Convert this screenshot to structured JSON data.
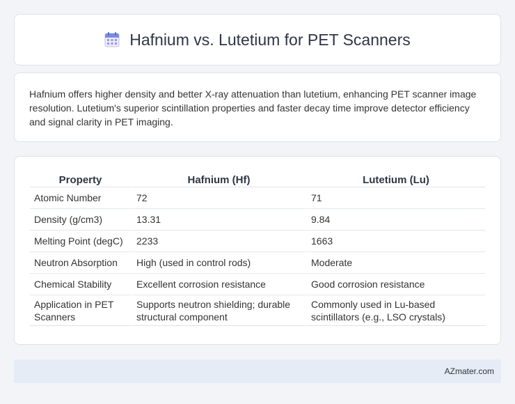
{
  "header": {
    "icon": "calendar-icon",
    "title": "Hafnium vs. Lutetium for PET Scanners"
  },
  "summary": {
    "text": "Hafnium offers higher density and better X-ray attenuation than lutetium, enhancing PET scanner image resolution. Lutetium's superior scintillation properties and faster decay time improve detector efficiency and signal clarity in PET imaging."
  },
  "table": {
    "headers": [
      "Property",
      "Hafnium (Hf)",
      "Lutetium (Lu)"
    ],
    "rows": [
      [
        "Atomic Number",
        "72",
        "71"
      ],
      [
        "Density (g/cm3)",
        "13.31",
        "9.84"
      ],
      [
        "Melting Point (degC)",
        "2233",
        "1663"
      ],
      [
        "Neutron Absorption",
        "High (used in control rods)",
        "Moderate"
      ],
      [
        "Chemical Stability",
        "Excellent corrosion resistance",
        "Good corrosion resistance"
      ],
      [
        "Application in PET Scanners",
        "Supports neutron shielding; durable structural component",
        "Commonly used in Lu-based scintillators (e.g., LSO crystals)"
      ]
    ]
  },
  "footer": {
    "brand": "AZmater.com"
  },
  "colors": {
    "background": "#f2f4f8",
    "card": "#ffffff",
    "footer": "#e6ecf6",
    "icon_accent": "#7b8cde"
  }
}
